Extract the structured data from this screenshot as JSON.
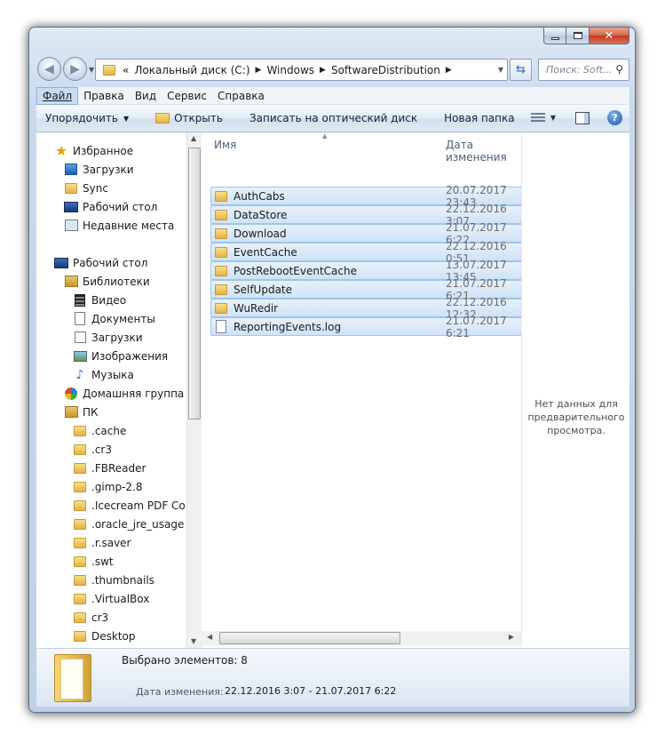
{
  "window": {
    "caption": {
      "minimize": "–",
      "maximize": "□",
      "close": "✕"
    }
  },
  "nav": {
    "back_icon": "back-arrow-icon",
    "forward_icon": "forward-arrow-icon"
  },
  "address": {
    "chevron": "«",
    "segments": [
      "Локальный диск (C:)",
      "Windows",
      "SoftwareDistribution"
    ]
  },
  "search": {
    "placeholder": "Поиск: Soft..."
  },
  "menu": [
    {
      "label": "Файл"
    },
    {
      "label": "Правка"
    },
    {
      "label": "Вид"
    },
    {
      "label": "Сервис"
    },
    {
      "label": "Справка"
    }
  ],
  "toolbar": {
    "organize": "Упорядочить",
    "open": "Открыть",
    "burn": "Записать на оптический диск",
    "new_folder": "Новая папка"
  },
  "navpane": {
    "favorites": "Избранное",
    "downloads": "Загрузки",
    "sync": "Sync",
    "desktop": "Рабочий стол",
    "recent": "Недавние места",
    "desktop2": "Рабочий стол",
    "libraries": "Библиотеки",
    "video": "Видео",
    "documents": "Документы",
    "lib_downloads": "Загрузки",
    "images": "Изображения",
    "music": "Музыка",
    "homegroup": "Домашняя группа",
    "pc": "ПК",
    "folders": [
      ".cache",
      ".cr3",
      ".FBReader",
      ".gimp-2.8",
      ".Icecream PDF Co",
      ".oracle_jre_usage",
      ".r.saver",
      ".swt",
      ".thumbnails",
      ".VirtualBox",
      "cr3",
      "Desktop"
    ]
  },
  "columns": {
    "name": "Имя",
    "date": "Дата изменения"
  },
  "files": [
    {
      "name": "AuthCabs",
      "date": "20.07.2017 23:43",
      "type": "folder"
    },
    {
      "name": "DataStore",
      "date": "22.12.2016 3:07",
      "type": "folder"
    },
    {
      "name": "Download",
      "date": "21.07.2017 6:22",
      "type": "folder"
    },
    {
      "name": "EventCache",
      "date": "22.12.2016 0:51",
      "type": "folder"
    },
    {
      "name": "PostRebootEventCache",
      "date": "13.07.2017 13:45",
      "type": "folder"
    },
    {
      "name": "SelfUpdate",
      "date": "21.07.2017 6:21",
      "type": "folder"
    },
    {
      "name": "WuRedir",
      "date": "22.12.2016 12:32",
      "type": "folder"
    },
    {
      "name": "ReportingEvents.log",
      "date": "21.07.2017 6:21",
      "type": "file"
    }
  ],
  "preview": {
    "line1": "Нет данных для",
    "line2": "предварительного",
    "line3": "просмотра."
  },
  "details": {
    "selected": "Выбрано элементов: 8",
    "modified_label": "Дата изменения:",
    "modified_value": "22.12.2016 3:07 - 21.07.2017 6:22"
  }
}
